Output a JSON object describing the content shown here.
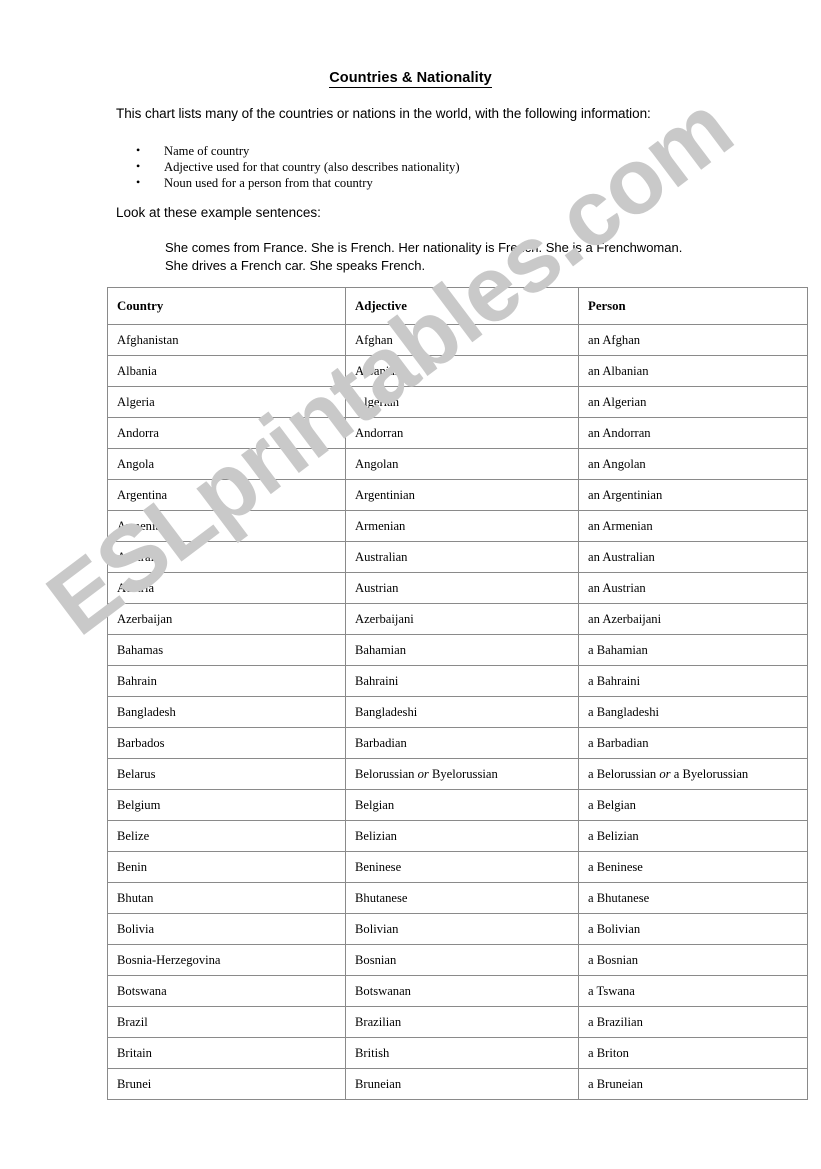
{
  "document": {
    "title": "Countries & Nationality",
    "intro": "This chart lists many of the countries or nations in the world, with the following information:",
    "bullets": [
      "Name of country",
      "Adjective used for that country (also describes nationality)",
      "Noun used for a person from that country"
    ],
    "look_line": "Look at these example sentences:",
    "example_lines": [
      "She comes from France. She is French. Her nationality is French. She is a Frenchwoman.",
      "She drives a French car. She speaks French."
    ]
  },
  "watermark": {
    "text": "ESLprintables.com",
    "color": "#c9c9c9"
  },
  "table": {
    "headers": [
      "Country",
      "Adjective",
      "Person"
    ],
    "rows": [
      [
        "Afghanistan",
        "Afghan",
        "an Afghan"
      ],
      [
        "Albania",
        "Albanian",
        "an Albanian"
      ],
      [
        "Algeria",
        "Algerian",
        "an Algerian"
      ],
      [
        "Andorra",
        "Andorran",
        "an Andorran"
      ],
      [
        "Angola",
        "Angolan",
        "an Angolan"
      ],
      [
        "Argentina",
        "Argentinian",
        "an Argentinian"
      ],
      [
        "Armenia",
        "Armenian",
        "an Armenian"
      ],
      [
        "Australia",
        "Australian",
        "an Australian"
      ],
      [
        "Austria",
        "Austrian",
        "an Austrian"
      ],
      [
        "Azerbaijan",
        "Azerbaijani",
        "an Azerbaijani"
      ],
      [
        "Bahamas",
        "Bahamian",
        "a Bahamian"
      ],
      [
        "Bahrain",
        "Bahraini",
        "a Bahraini"
      ],
      [
        "Bangladesh",
        "Bangladeshi",
        "a Bangladeshi"
      ],
      [
        "Barbados",
        "Barbadian",
        "a Barbadian"
      ],
      [
        "Belarus",
        "Belorussian or Byelorussian",
        "a Belorussian or a Byelorussian"
      ],
      [
        "Belgium",
        "Belgian",
        "a Belgian"
      ],
      [
        "Belize",
        "Belizian",
        "a Belizian"
      ],
      [
        "Benin",
        "Beninese",
        "a Beninese"
      ],
      [
        "Bhutan",
        "Bhutanese",
        "a Bhutanese"
      ],
      [
        "Bolivia",
        "Bolivian",
        "a Bolivian"
      ],
      [
        "Bosnia-Herzegovina",
        "Bosnian",
        "a Bosnian"
      ],
      [
        "Botswana",
        "Botswanan",
        "a Tswana"
      ],
      [
        "Brazil",
        "Brazilian",
        "a Brazilian"
      ],
      [
        "Britain",
        "British",
        "a Briton"
      ],
      [
        "Brunei",
        "Bruneian",
        "a Bruneian"
      ]
    ],
    "italic_word": "or"
  }
}
